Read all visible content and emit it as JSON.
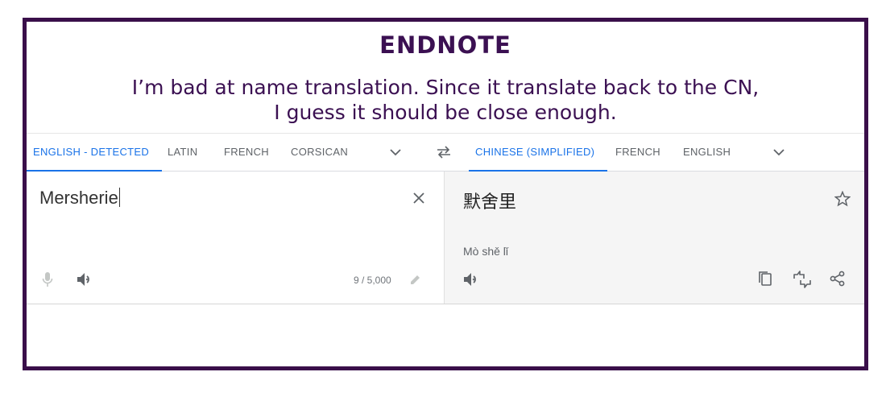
{
  "endnote": {
    "title": "ENDNOTE",
    "line1": "I’m bad at name translation. Since it translate back to the CN,",
    "line2": "I guess it should be close enough."
  },
  "source_tabs": [
    "ENGLISH - DETECTED",
    "LATIN",
    "FRENCH",
    "CORSICAN"
  ],
  "target_tabs": [
    "CHINESE (SIMPLIFIED)",
    "FRENCH",
    "ENGLISH"
  ],
  "source": {
    "text": "Mersherie",
    "char_count": "9 / 5,000"
  },
  "target": {
    "text": "默舍里",
    "transliteration": "Mò shě lǐ"
  },
  "icons": {
    "source": [
      "close-icon",
      "microphone-icon",
      "speaker-icon",
      "pencil-icon"
    ],
    "target": [
      "star-icon",
      "speaker-icon",
      "copy-icon",
      "feedback-icon",
      "share-icon"
    ],
    "tabs": [
      "chevron-down-icon",
      "swap-icon"
    ]
  },
  "colors": {
    "frame": "#3a0f4a",
    "endnote_text": "#3b1052",
    "accent": "#1a73e8"
  }
}
